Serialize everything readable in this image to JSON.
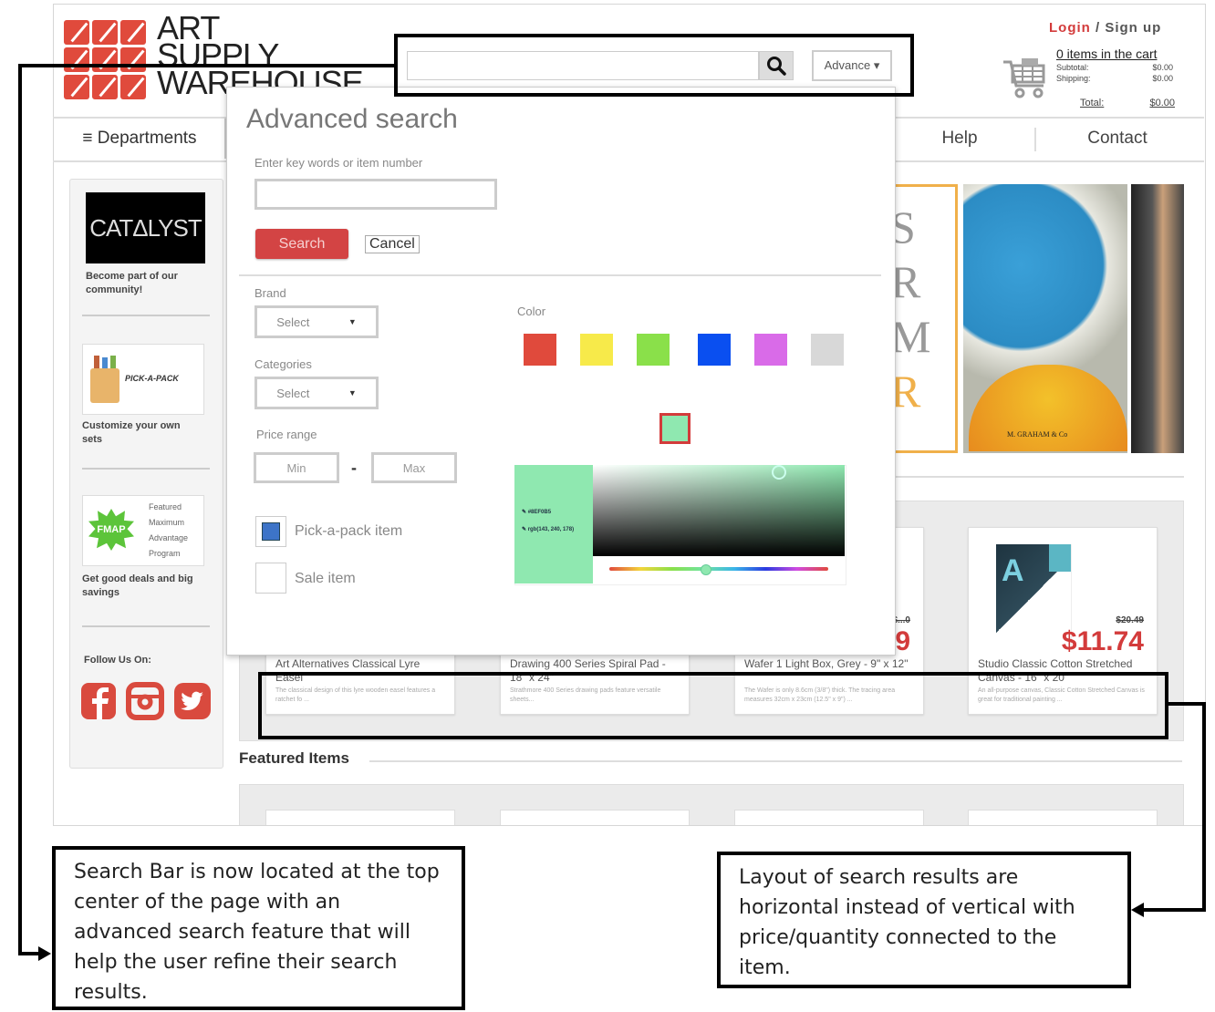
{
  "logo": {
    "lines": [
      "ART",
      "SUPPLY",
      "WAREHOUSE"
    ]
  },
  "header": {
    "search": {
      "value": "",
      "placeholder": "",
      "button_icon": "search-icon",
      "advance_label": "Advance ▾"
    },
    "login": {
      "login_label": "Login",
      "separator": " / ",
      "signup_label": "Sign up"
    },
    "cart": {
      "items_label": "0 items in the cart",
      "subtotal_label": "Subtotal:",
      "subtotal_value": "$0.00",
      "shipping_label": "Shipping:",
      "shipping_value": "$0.00",
      "total_label": "Total:",
      "total_value": "$0.00"
    }
  },
  "nav": {
    "departments": "≡ Departments",
    "help": "Help",
    "contact": "Contact"
  },
  "sidebar": {
    "catalyst_logo": "CATΔLYST",
    "catalyst_text": "Become part of our community!",
    "pickapack_logo": "PICK-A-PACK",
    "pickapack_text": "Customize your own sets",
    "fmap_badge": "FMAP",
    "fmap_lines": [
      "Featured",
      "Maximum",
      "Advantage",
      "Program"
    ],
    "fmap_text": "Get good deals and big savings",
    "follow_label": "Follow Us On:",
    "social": [
      "facebook-icon",
      "instagram-icon",
      "twitter-icon"
    ]
  },
  "banner": {
    "letters": [
      "S",
      "R",
      "M",
      "R"
    ],
    "brand": "M. GRAHAM & Co"
  },
  "advanced_search": {
    "title": "Advanced search",
    "keywords_label": "Enter key words or item number",
    "keywords_value": "",
    "search_button": "Search",
    "cancel_button": "Cancel",
    "brand_label": "Brand",
    "brand_value": "Select",
    "categories_label": "Categories",
    "categories_value": "Select",
    "price_label": "Price range",
    "price_min_placeholder": "Min",
    "price_max_placeholder": "Max",
    "price_separator": "-",
    "pickapack_label": "Pick-a-pack item",
    "pickapack_checked": true,
    "sale_label": "Sale item",
    "sale_checked": false,
    "color_label": "Color",
    "swatches": [
      "#e04a3c",
      "#f7ea4a",
      "#8ae04a",
      "#0a4ff0",
      "#d96be8",
      "#d8d8d8"
    ],
    "selected_color": "#8fe8b0",
    "picker_hex": "#8EF0B5",
    "picker_rgb": "rgb(143, 240, 178)"
  },
  "results": {
    "items": [
      {
        "title": "Art Alternatives Classical Lyre Easel",
        "desc": "The classical design of this lyre wooden easel features a ratchet fo ...",
        "old_price": "",
        "price": ""
      },
      {
        "title": "Drawing 400 Series Spiral Pad - 18\" x 24\"",
        "desc": "Strathmore 400 Series drawing pads feature versatile sheets...",
        "old_price": "",
        "price": ""
      },
      {
        "title": "Wafer 1 Light Box, Grey - 9\" x 12\"",
        "desc": "The Wafer is only 8.6cm (3/8\") thick. The tracing area measures 32cm x 23cm (12.5\" x 9\") ...",
        "old_price": "$...0",
        "price": "$...9"
      },
      {
        "title": "Studio Classic Cotton Stretched Canvas - 16\" x 20\"",
        "desc": "An all-purpose canvas, Classic Cotton Stretched Canvas is great for traditional painting ...",
        "old_price": "$20.49",
        "price": "$11.74"
      }
    ]
  },
  "featured": {
    "title": "Featured Items"
  },
  "annotations": {
    "left": "Search Bar is now located at the top center of the page with an advanced search feature that will help the user refine their search results.",
    "right": "Layout of search results are horizontal instead of vertical with price/quantity connected to the item."
  },
  "colors": {
    "brand_red": "#d33b3b",
    "logo_red": "#e04a3c"
  }
}
